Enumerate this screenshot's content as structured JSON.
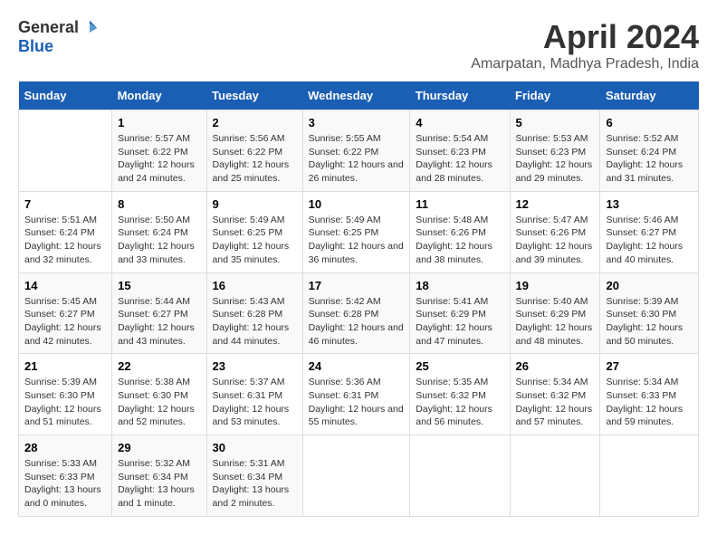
{
  "logo": {
    "general": "General",
    "blue": "Blue"
  },
  "title": "April 2024",
  "subtitle": "Amarpatan, Madhya Pradesh, India",
  "weekdays": [
    "Sunday",
    "Monday",
    "Tuesday",
    "Wednesday",
    "Thursday",
    "Friday",
    "Saturday"
  ],
  "weeks": [
    [
      {
        "day": null
      },
      {
        "day": 1,
        "sunrise": "5:57 AM",
        "sunset": "6:22 PM",
        "daylight": "12 hours and 24 minutes."
      },
      {
        "day": 2,
        "sunrise": "5:56 AM",
        "sunset": "6:22 PM",
        "daylight": "12 hours and 25 minutes."
      },
      {
        "day": 3,
        "sunrise": "5:55 AM",
        "sunset": "6:22 PM",
        "daylight": "12 hours and 26 minutes."
      },
      {
        "day": 4,
        "sunrise": "5:54 AM",
        "sunset": "6:23 PM",
        "daylight": "12 hours and 28 minutes."
      },
      {
        "day": 5,
        "sunrise": "5:53 AM",
        "sunset": "6:23 PM",
        "daylight": "12 hours and 29 minutes."
      },
      {
        "day": 6,
        "sunrise": "5:52 AM",
        "sunset": "6:24 PM",
        "daylight": "12 hours and 31 minutes."
      }
    ],
    [
      {
        "day": 7,
        "sunrise": "5:51 AM",
        "sunset": "6:24 PM",
        "daylight": "12 hours and 32 minutes."
      },
      {
        "day": 8,
        "sunrise": "5:50 AM",
        "sunset": "6:24 PM",
        "daylight": "12 hours and 33 minutes."
      },
      {
        "day": 9,
        "sunrise": "5:49 AM",
        "sunset": "6:25 PM",
        "daylight": "12 hours and 35 minutes."
      },
      {
        "day": 10,
        "sunrise": "5:49 AM",
        "sunset": "6:25 PM",
        "daylight": "12 hours and 36 minutes."
      },
      {
        "day": 11,
        "sunrise": "5:48 AM",
        "sunset": "6:26 PM",
        "daylight": "12 hours and 38 minutes."
      },
      {
        "day": 12,
        "sunrise": "5:47 AM",
        "sunset": "6:26 PM",
        "daylight": "12 hours and 39 minutes."
      },
      {
        "day": 13,
        "sunrise": "5:46 AM",
        "sunset": "6:27 PM",
        "daylight": "12 hours and 40 minutes."
      }
    ],
    [
      {
        "day": 14,
        "sunrise": "5:45 AM",
        "sunset": "6:27 PM",
        "daylight": "12 hours and 42 minutes."
      },
      {
        "day": 15,
        "sunrise": "5:44 AM",
        "sunset": "6:27 PM",
        "daylight": "12 hours and 43 minutes."
      },
      {
        "day": 16,
        "sunrise": "5:43 AM",
        "sunset": "6:28 PM",
        "daylight": "12 hours and 44 minutes."
      },
      {
        "day": 17,
        "sunrise": "5:42 AM",
        "sunset": "6:28 PM",
        "daylight": "12 hours and 46 minutes."
      },
      {
        "day": 18,
        "sunrise": "5:41 AM",
        "sunset": "6:29 PM",
        "daylight": "12 hours and 47 minutes."
      },
      {
        "day": 19,
        "sunrise": "5:40 AM",
        "sunset": "6:29 PM",
        "daylight": "12 hours and 48 minutes."
      },
      {
        "day": 20,
        "sunrise": "5:39 AM",
        "sunset": "6:30 PM",
        "daylight": "12 hours and 50 minutes."
      }
    ],
    [
      {
        "day": 21,
        "sunrise": "5:39 AM",
        "sunset": "6:30 PM",
        "daylight": "12 hours and 51 minutes."
      },
      {
        "day": 22,
        "sunrise": "5:38 AM",
        "sunset": "6:30 PM",
        "daylight": "12 hours and 52 minutes."
      },
      {
        "day": 23,
        "sunrise": "5:37 AM",
        "sunset": "6:31 PM",
        "daylight": "12 hours and 53 minutes."
      },
      {
        "day": 24,
        "sunrise": "5:36 AM",
        "sunset": "6:31 PM",
        "daylight": "12 hours and 55 minutes."
      },
      {
        "day": 25,
        "sunrise": "5:35 AM",
        "sunset": "6:32 PM",
        "daylight": "12 hours and 56 minutes."
      },
      {
        "day": 26,
        "sunrise": "5:34 AM",
        "sunset": "6:32 PM",
        "daylight": "12 hours and 57 minutes."
      },
      {
        "day": 27,
        "sunrise": "5:34 AM",
        "sunset": "6:33 PM",
        "daylight": "12 hours and 59 minutes."
      }
    ],
    [
      {
        "day": 28,
        "sunrise": "5:33 AM",
        "sunset": "6:33 PM",
        "daylight": "13 hours and 0 minutes."
      },
      {
        "day": 29,
        "sunrise": "5:32 AM",
        "sunset": "6:34 PM",
        "daylight": "13 hours and 1 minute."
      },
      {
        "day": 30,
        "sunrise": "5:31 AM",
        "sunset": "6:34 PM",
        "daylight": "13 hours and 2 minutes."
      },
      {
        "day": null
      },
      {
        "day": null
      },
      {
        "day": null
      },
      {
        "day": null
      }
    ]
  ],
  "labels": {
    "sunrise": "Sunrise:",
    "sunset": "Sunset:",
    "daylight": "Daylight:"
  }
}
